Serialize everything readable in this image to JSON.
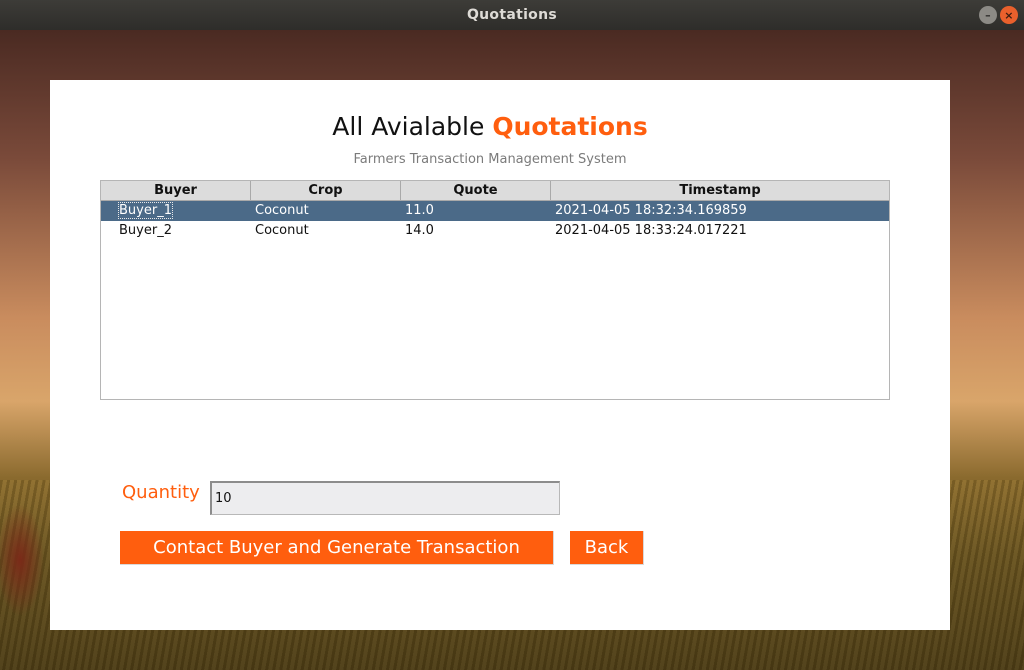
{
  "window": {
    "title": "Quotations",
    "minimize_glyph": "–",
    "close_glyph": "×"
  },
  "heading": {
    "prefix": "All Avialable ",
    "accent": "Quotations"
  },
  "subtitle": "Farmers Transaction Management System",
  "table": {
    "columns": [
      "Buyer",
      "Crop",
      "Quote",
      "Timestamp"
    ],
    "rows": [
      {
        "buyer": "Buyer_1",
        "crop": "Coconut",
        "quote": "11.0",
        "timestamp": "2021-04-05 18:32:34.169859",
        "selected": true
      },
      {
        "buyer": "Buyer_2",
        "crop": "Coconut",
        "quote": "14.0",
        "timestamp": "2021-04-05 18:33:24.017221",
        "selected": false
      }
    ]
  },
  "quantity": {
    "label": "Quantity",
    "value": "10"
  },
  "buttons": {
    "contact": "Contact Buyer and Generate Transaction",
    "back": "Back"
  },
  "colors": {
    "accent": "#ff5e0e",
    "selected_row": "#4b6a88"
  }
}
